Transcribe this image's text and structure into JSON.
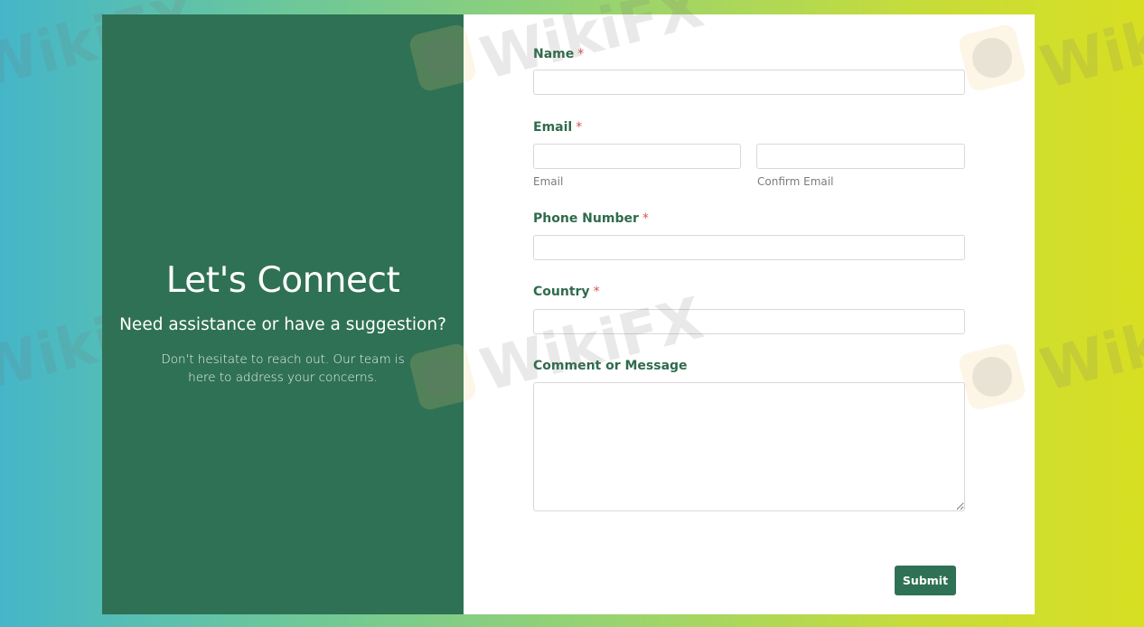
{
  "left_panel": {
    "title": "Let's Connect",
    "subtitle": "Need assistance or have a suggestion?",
    "description": "Don't hesitate to reach out. Our team is here to address your concerns."
  },
  "form": {
    "required_marker": "*",
    "name": {
      "label": "Name",
      "value": ""
    },
    "email": {
      "label": "Email",
      "email_value": "",
      "email_sublabel": "Email",
      "confirm_value": "",
      "confirm_sublabel": "Confirm Email"
    },
    "phone": {
      "label": "Phone Number",
      "value": ""
    },
    "country": {
      "label": "Country",
      "value": ""
    },
    "message": {
      "label": "Comment or Message",
      "value": ""
    },
    "submit_label": "Submit"
  },
  "watermark": {
    "text": "WikiFX"
  },
  "colors": {
    "brand_green": "#2f7154",
    "label_green": "#2f6b4c",
    "required_red": "#d9534f"
  }
}
